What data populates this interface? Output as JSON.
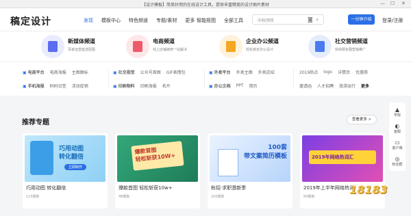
{
  "window": {
    "title": "【设计模板】简单好用的在线设计工具，提供丰富精美的设计图片素材"
  },
  "header": {
    "logo": "稿定设计",
    "nav": [
      "发现",
      "模板中心",
      "特色频道",
      "专题/素材",
      "更多"
    ],
    "nav2": [
      "智能抠图",
      "全部工具"
    ],
    "search_placeholder": "中秋预热",
    "make_button": "一分钟介绍",
    "login": "登录/注册"
  },
  "channels": [
    {
      "name": "新媒体频道",
      "desc": "百家运营首选配图",
      "color": "#5b6cf0",
      "bg": "#e9ecfd"
    },
    {
      "name": "电商频道",
      "desc": "线上店铺装修一站解决",
      "color": "#ef5a6a",
      "bg": "#fde7e9"
    },
    {
      "name": "企业办公频道",
      "desc": "轻松搞定办公设计",
      "color": "#f5a623",
      "bg": "#fff2dc"
    },
    {
      "name": "社交营销频道",
      "desc": "快快朋友圈营销推广",
      "color": "#4a7cf0",
      "bg": "#e5edfd"
    }
  ],
  "categories": {
    "row1": [
      {
        "head": "电商平台",
        "items": [
          "电商海报",
          "主图图标"
        ]
      },
      {
        "head": "社交视觉",
        "items": [
          "公众号首图",
          "GIF表情包"
        ]
      },
      {
        "head": "外卖平台",
        "items": [
          "外卖主图",
          "外卖店招"
        ]
      },
      {
        "head": "2019热点",
        "items": [
          "logo",
          "详情页",
          "优惠券"
        ]
      }
    ],
    "row2": [
      {
        "head": "手机海报",
        "items": [
          "码码日签",
          "活动促销"
        ]
      },
      {
        "head": "印刷物料",
        "items": [
          "印刷海报",
          "名片"
        ]
      },
      {
        "head": "办公文档",
        "items": [
          "PPT",
          "简历"
        ]
      },
      {
        "head": "邀请函",
        "items": [
          "人才招聘",
          "旅游出行",
          "更多"
        ]
      }
    ]
  },
  "section": {
    "title": "推荐专题",
    "more": "查看更多 >"
  },
  "cards": [
    {
      "title": "巧用动图 转化翻倍",
      "count": "115模板",
      "img_text": "巧用动图\n转化翻倍",
      "img_sub": "立即制作"
    },
    {
      "title": "爆款首图 轻松斩获10w+",
      "count": "48模板",
      "img_text": "爆款首图\n轻松斩获10W+"
    },
    {
      "title": "秋招·求职激新季",
      "count": "100模板",
      "img_text": "100套\n带文案简历模板"
    },
    {
      "title": "2019年上半年网络热词",
      "count": "84模板",
      "img_text": "2019年网络热词汇"
    }
  ],
  "rail": [
    "学院",
    "客服",
    "客户端",
    "粉丝群"
  ],
  "watermark": "18183"
}
